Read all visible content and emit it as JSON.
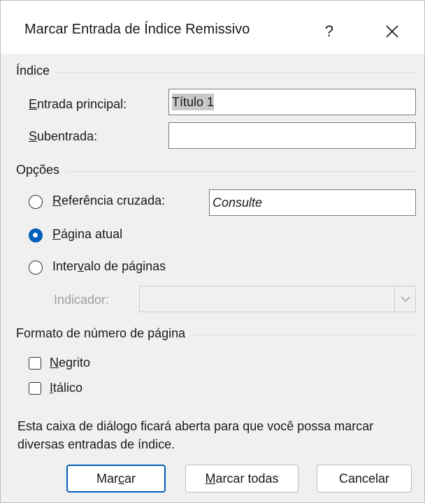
{
  "dialog": {
    "title": "Marcar Entrada de Índice Remissivo",
    "help_label": "?",
    "close_icon": "close-icon"
  },
  "index_section": {
    "label": "Índice",
    "main_entry": {
      "label_underlined": "E",
      "label_rest": "ntrada principal:",
      "value": "Título 1"
    },
    "subentry": {
      "label_underlined": "S",
      "label_rest": "ubentrada:",
      "value": ""
    }
  },
  "options_section": {
    "label": "Opções",
    "cross_reference": {
      "label_underlined": "R",
      "label_rest": "eferência cruzada:",
      "value": "Consulte",
      "checked": false
    },
    "current_page": {
      "label_underlined": "P",
      "label_rest": "ágina atual",
      "checked": true
    },
    "page_range": {
      "label_pre": "Inter",
      "label_underlined": "v",
      "label_rest": "alo de páginas",
      "checked": false
    },
    "bookmark": {
      "label": "Indicador:",
      "value": "",
      "enabled": false
    }
  },
  "page_number_format": {
    "label": "Formato de número de página",
    "bold": {
      "label_underlined": "N",
      "label_rest": "egrito",
      "checked": false
    },
    "italic": {
      "label_underlined": "I",
      "label_rest": "tálico",
      "checked": false
    }
  },
  "info": {
    "text": "Esta caixa de diálogo ficará aberta para que você possa marcar diversas entradas de índice."
  },
  "buttons": {
    "mark": {
      "label_pre": "Mar",
      "label_underlined": "c",
      "label_rest": "ar"
    },
    "mark_all": {
      "label_underlined": "M",
      "label_rest": "arcar todas"
    },
    "cancel": {
      "label": "Cancelar"
    }
  },
  "colors": {
    "accent": "#005fb8",
    "background": "#f0f0f0",
    "selection": "#c8c8c8"
  }
}
